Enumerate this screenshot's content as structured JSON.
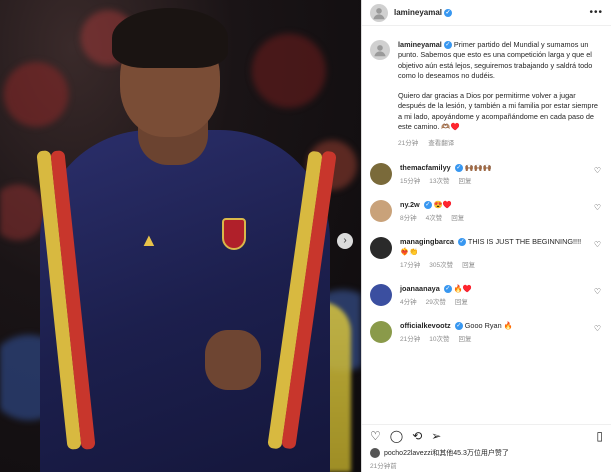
{
  "header": {
    "username": "lamineyamal",
    "more_icon": "more-icon"
  },
  "caption": {
    "username": "lamineyamal",
    "paragraph1": "Primer partido del Mundial y sumamos un punto. Sabemos que esto es una competición larga y que el objetivo aún está lejos, seguiremos trabajando y saldrá todo como lo deseamos no dudéis.",
    "paragraph2": "Quiero dar gracias a Dios por permitirme volver a jugar después de la lesión, y también a mi familia por estar siempre a mi lado, apoyándome y acompañándome en cada paso de este camino. 🫶🏽♥️",
    "time": "21分钟",
    "translate": "查看翻译"
  },
  "comments": [
    {
      "username": "themacfamilyy",
      "verified": true,
      "text": "🙌🏾🙌🏾🙌🏾",
      "time": "15分钟",
      "likes": "13次赞",
      "reply": "回复",
      "avatar_color": "#7a6a3a"
    },
    {
      "username": "ny.2w",
      "verified": true,
      "text": "😍♥️",
      "time": "8分钟",
      "likes": "4次赞",
      "reply": "回复",
      "avatar_color": "#c9a27a"
    },
    {
      "username": "managingbarca",
      "verified": true,
      "text": "THIS IS JUST THE BEGINNING!!!! ❤️‍🔥👏",
      "time": "17分钟",
      "likes": "305次赞",
      "reply": "回复",
      "avatar_color": "#2a2a2a"
    },
    {
      "username": "joanaanaya",
      "verified": true,
      "text": "🔥♥️",
      "time": "4分钟",
      "likes": "29次赞",
      "reply": "回复",
      "avatar_color": "#3b4fa0"
    },
    {
      "username": "officialkevootz",
      "verified": true,
      "text": "Gooo Ryan 🔥",
      "time": "21分钟",
      "likes": "10次赞",
      "reply": "回复",
      "avatar_color": "#8a9a4a"
    }
  ],
  "liked_by": {
    "text": "pocho22lavezzi和其他45.3万位用户赞了"
  },
  "post_time": "21分钟前"
}
